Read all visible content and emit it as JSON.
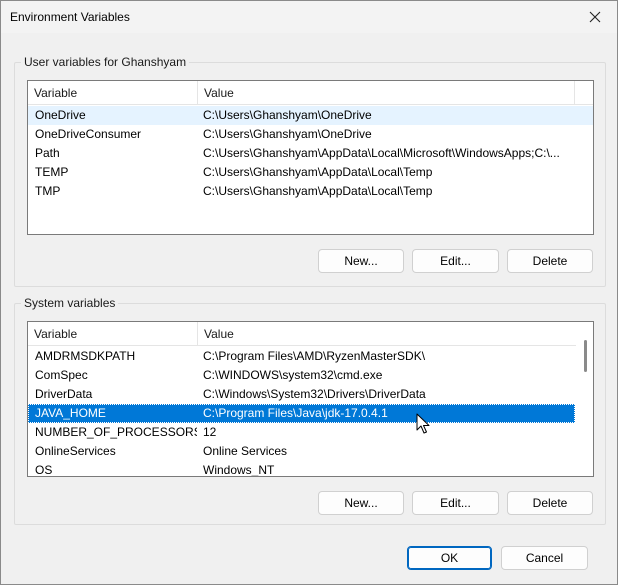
{
  "window": {
    "title": "Environment Variables"
  },
  "user_vars": {
    "group_label": "User variables for Ghanshyam",
    "columns": [
      "Variable",
      "Value"
    ],
    "rows": [
      {
        "variable": "OneDrive",
        "value": "C:\\Users\\Ghanshyam\\OneDrive"
      },
      {
        "variable": "OneDriveConsumer",
        "value": "C:\\Users\\Ghanshyam\\OneDrive"
      },
      {
        "variable": "Path",
        "value": "C:\\Users\\Ghanshyam\\AppData\\Local\\Microsoft\\WindowsApps;C:\\..."
      },
      {
        "variable": "TEMP",
        "value": "C:\\Users\\Ghanshyam\\AppData\\Local\\Temp"
      },
      {
        "variable": "TMP",
        "value": "C:\\Users\\Ghanshyam\\AppData\\Local\\Temp"
      }
    ],
    "buttons": {
      "new": "New...",
      "edit": "Edit...",
      "delete": "Delete"
    }
  },
  "system_vars": {
    "group_label": "System variables",
    "columns": [
      "Variable",
      "Value"
    ],
    "rows": [
      {
        "variable": "AMDRMSDKPATH",
        "value": "C:\\Program Files\\AMD\\RyzenMasterSDK\\"
      },
      {
        "variable": "ComSpec",
        "value": "C:\\WINDOWS\\system32\\cmd.exe"
      },
      {
        "variable": "DriverData",
        "value": "C:\\Windows\\System32\\Drivers\\DriverData"
      },
      {
        "variable": "JAVA_HOME",
        "value": "C:\\Program Files\\Java\\jdk-17.0.4.1"
      },
      {
        "variable": "NUMBER_OF_PROCESSORS",
        "value": "12"
      },
      {
        "variable": "OnlineServices",
        "value": "Online Services"
      },
      {
        "variable": "OS",
        "value": "Windows_NT"
      }
    ],
    "selected_variable": "JAVA_HOME",
    "buttons": {
      "new": "New...",
      "edit": "Edit...",
      "delete": "Delete"
    }
  },
  "footer": {
    "ok": "OK",
    "cancel": "Cancel"
  },
  "colors": {
    "selection": "#0078d7",
    "hover": "#e5f3ff",
    "primary_border": "#0067c0"
  },
  "icons": {
    "close": "close-icon",
    "cursor": "mouse-pointer-icon"
  }
}
